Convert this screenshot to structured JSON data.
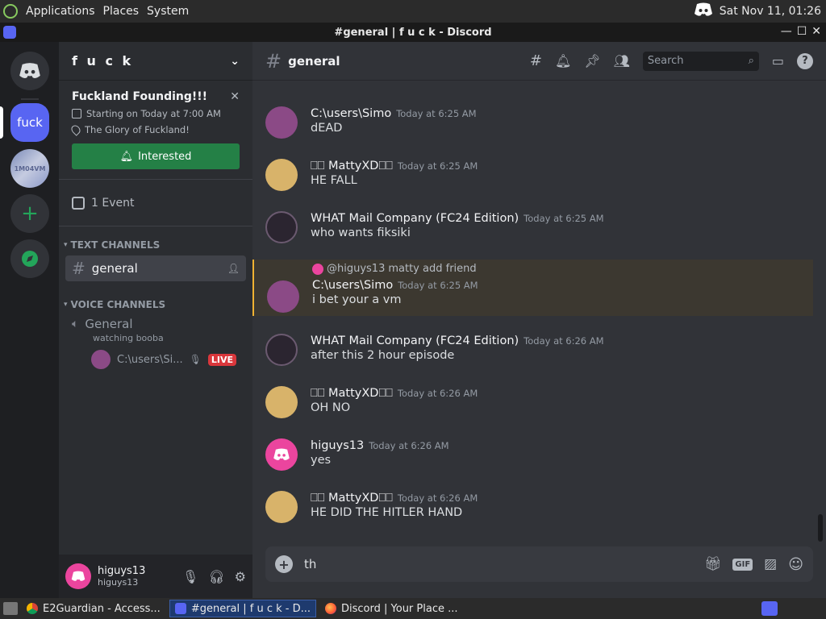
{
  "system_bar": {
    "menus": [
      "Applications",
      "Places",
      "System"
    ],
    "datetime": "Sat Nov 11, 01:26"
  },
  "window": {
    "title": "#general | f u c k - Discord"
  },
  "guilds": {
    "items": [
      {
        "label": "fuck"
      },
      {
        "label": "1M04VM"
      }
    ]
  },
  "server": {
    "name": "f u c k",
    "event": {
      "title": "Fuckland Founding!!!",
      "time": "Starting on Today at 7:00 AM",
      "location": "The Glory of Fuckland!",
      "button": "Interested"
    },
    "events_count": "1 Event",
    "text_category": "TEXT CHANNELS",
    "text_channels": [
      {
        "name": "general"
      }
    ],
    "voice_category": "VOICE CHANNELS",
    "voice_channels": [
      {
        "name": "General",
        "status": "watching booba",
        "member": "C:\\users\\Si...",
        "live": "LIVE"
      }
    ]
  },
  "user": {
    "display_name": "higuys13",
    "username": "higuys13"
  },
  "channel": {
    "name": "general",
    "search_placeholder": "Search"
  },
  "messages": [
    {
      "author": "C:\\users\\Simo",
      "time": "Today at 6:25 AM",
      "text": "dEAD",
      "avatar_color": "#8b4a86"
    },
    {
      "author": "⎕⎕ MattyXD⎕⎕",
      "time": "Today at 6:25 AM",
      "text": "HE FALL",
      "avatar_color": "#d8b36a"
    },
    {
      "author": "WHAT Mail Company (FC24 Edition)",
      "time": "Today at 6:25 AM",
      "text": "who wants fiksiki",
      "avatar_color": "#2b2530"
    },
    {
      "reply_to": "@higuys13",
      "reply_text": "matty add friend",
      "author": "C:\\users\\Simo",
      "time": "Today at 6:25 AM",
      "text": "i bet your a vm",
      "avatar_color": "#8b4a86"
    },
    {
      "author": "WHAT Mail Company (FC24 Edition)",
      "time": "Today at 6:26 AM",
      "text": "after this 2 hour episode",
      "avatar_color": "#2b2530"
    },
    {
      "author": "⎕⎕ MattyXD⎕⎕",
      "time": "Today at 6:26 AM",
      "text": "OH NO",
      "avatar_color": "#d8b36a"
    },
    {
      "author": "higuys13",
      "time": "Today at 6:26 AM",
      "text": "yes",
      "avatar_color": "#eb459e"
    },
    {
      "author": "⎕⎕ MattyXD⎕⎕",
      "time": "Today at 6:26 AM",
      "text": "HE DID THE HITLER HAND",
      "avatar_color": "#d8b36a"
    }
  ],
  "composer": {
    "value": "th"
  },
  "taskbar": {
    "items": [
      {
        "label": "E2Guardian - Access..."
      },
      {
        "label": "#general | f u c k - D..."
      },
      {
        "label": "Discord | Your Place ..."
      }
    ]
  },
  "colors": {
    "blurple": "#5865f2",
    "green": "#248046",
    "live_red": "#da373c",
    "mention_bar": "#f0b232"
  }
}
